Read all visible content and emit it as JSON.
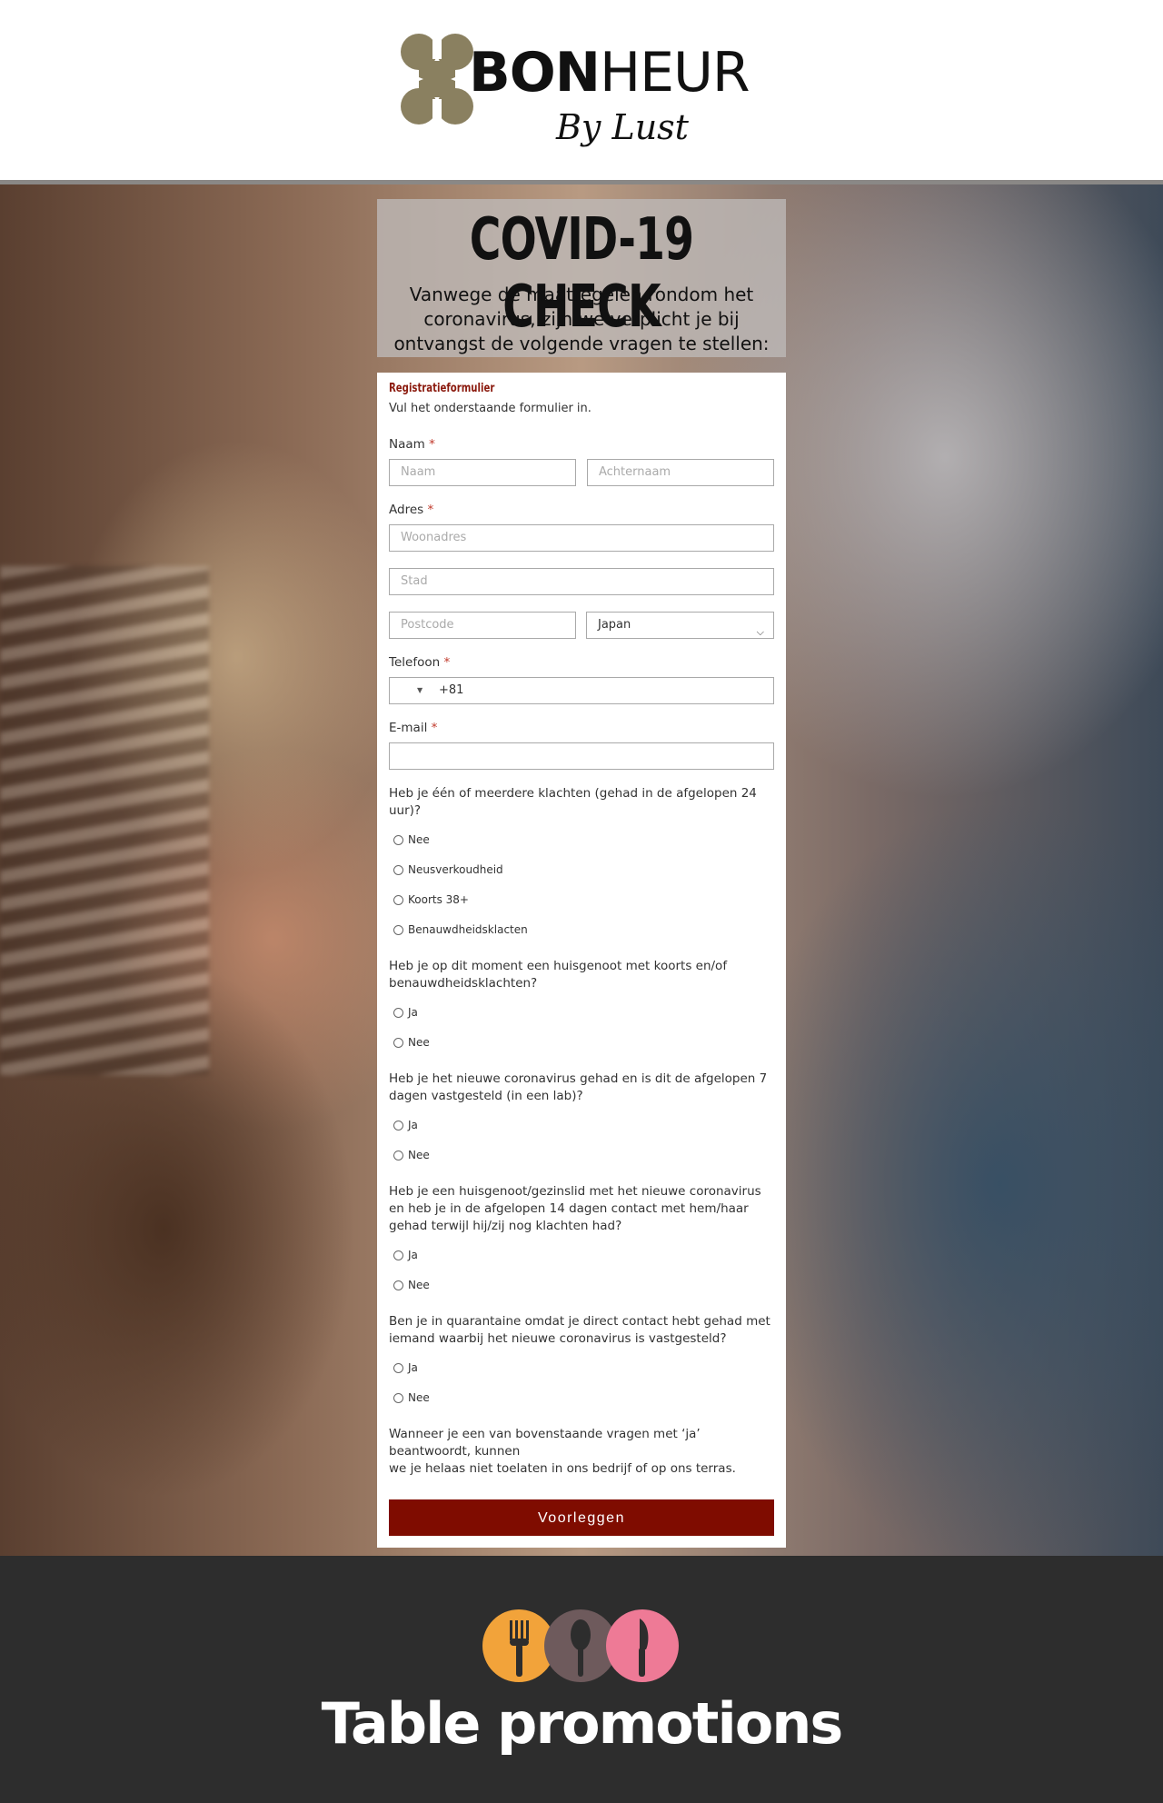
{
  "header": {
    "logo_bold": "BON",
    "logo_light": "HEUR",
    "logo_sub": "By Lust",
    "logo_color": "#8a8060"
  },
  "hero": {
    "title": "COVID-19 CHECK",
    "intro": "Vanwege de maatregelen rondom het coronavirus, zijn we verplicht je bij ontvangst de volgende vragen te stellen:"
  },
  "form": {
    "title": "Registratieformulier",
    "subtitle": "Vul het onderstaande formulier in.",
    "naam_label": "Naam",
    "first_name_placeholder": "Naam",
    "last_name_placeholder": "Achternaam",
    "adres_label": "Adres",
    "street_placeholder": "Woonadres",
    "city_placeholder": "Stad",
    "postcode_placeholder": "Postcode",
    "country_value": "Japan",
    "telefoon_label": "Telefoon",
    "phone_prefix": "+81",
    "email_label": "E-mail",
    "required_mark": "*",
    "questions": [
      {
        "text": "Heb je één of meerdere klachten (gehad in de afgelopen 24 uur)?",
        "options": [
          "Nee",
          "Neusverkoudheid",
          "Koorts 38+",
          "Benauwdheidsklacten"
        ]
      },
      {
        "text": "Heb je op dit moment een huisgenoot met koorts en/of benauwdheidsklachten?",
        "options": [
          "Ja",
          "Nee"
        ]
      },
      {
        "text": "Heb je het nieuwe coronavirus gehad en is dit de afgelopen 7 dagen vastgesteld (in een lab)?",
        "options": [
          "Ja",
          "Nee"
        ]
      },
      {
        "text": "Heb je een huisgenoot/gezinslid met het nieuwe coronavirus en heb je in de afgelopen 14 dagen contact met hem/haar gehad terwijl hij/zij nog klachten had?",
        "options": [
          "Ja",
          "Nee"
        ]
      },
      {
        "text": "Ben je in quarantaine omdat je direct contact hebt gehad met iemand waarbij het nieuwe coronavirus is vastgesteld?",
        "options": [
          "Ja",
          "Nee"
        ]
      }
    ],
    "note_line1": "Wanneer je een van bovenstaande vragen met ‘ja’ beantwoordt, kunnen",
    "note_line2": "we je helaas niet toelaten in ons bedrijf of op ons terras.",
    "submit_label": "Voorleggen",
    "submit_color": "#7f0c00"
  },
  "footer": {
    "title": "Table promotions",
    "circle_colors": [
      "#f2a33a",
      "#6e5a5c",
      "#ee7a96"
    ],
    "icons": [
      "fork-icon",
      "spoon-icon",
      "knife-icon"
    ]
  }
}
